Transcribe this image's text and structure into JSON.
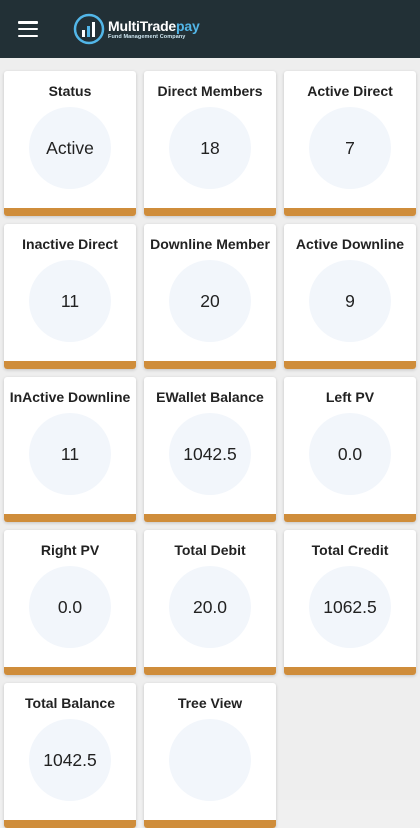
{
  "header": {
    "logo_title_main": "MultiTrade",
    "logo_title_accent": "pay",
    "logo_subtitle": "Fund Management Company"
  },
  "cards": [
    {
      "title": "Status",
      "value": "Active"
    },
    {
      "title": "Direct Members",
      "value": "18"
    },
    {
      "title": "Active Direct",
      "value": "7"
    },
    {
      "title": "Inactive Direct",
      "value": "11"
    },
    {
      "title": "Downline Member",
      "value": "20"
    },
    {
      "title": "Active Downline",
      "value": "9"
    },
    {
      "title": "InActive Downline",
      "value": "11"
    },
    {
      "title": "EWallet Balance",
      "value": "1042.5"
    },
    {
      "title": "Left PV",
      "value": "0.0"
    },
    {
      "title": "Right PV",
      "value": "0.0"
    },
    {
      "title": "Total Debit",
      "value": "20.0"
    },
    {
      "title": "Total Credit",
      "value": "1062.5"
    },
    {
      "title": "Total Balance",
      "value": "1042.5"
    },
    {
      "title": "Tree View",
      "value": ""
    }
  ],
  "colors": {
    "header_bg": "#223036",
    "card_bar": "#cf8d3b",
    "circle_bg": "#f2f6fb",
    "accent": "#52b6e8"
  }
}
